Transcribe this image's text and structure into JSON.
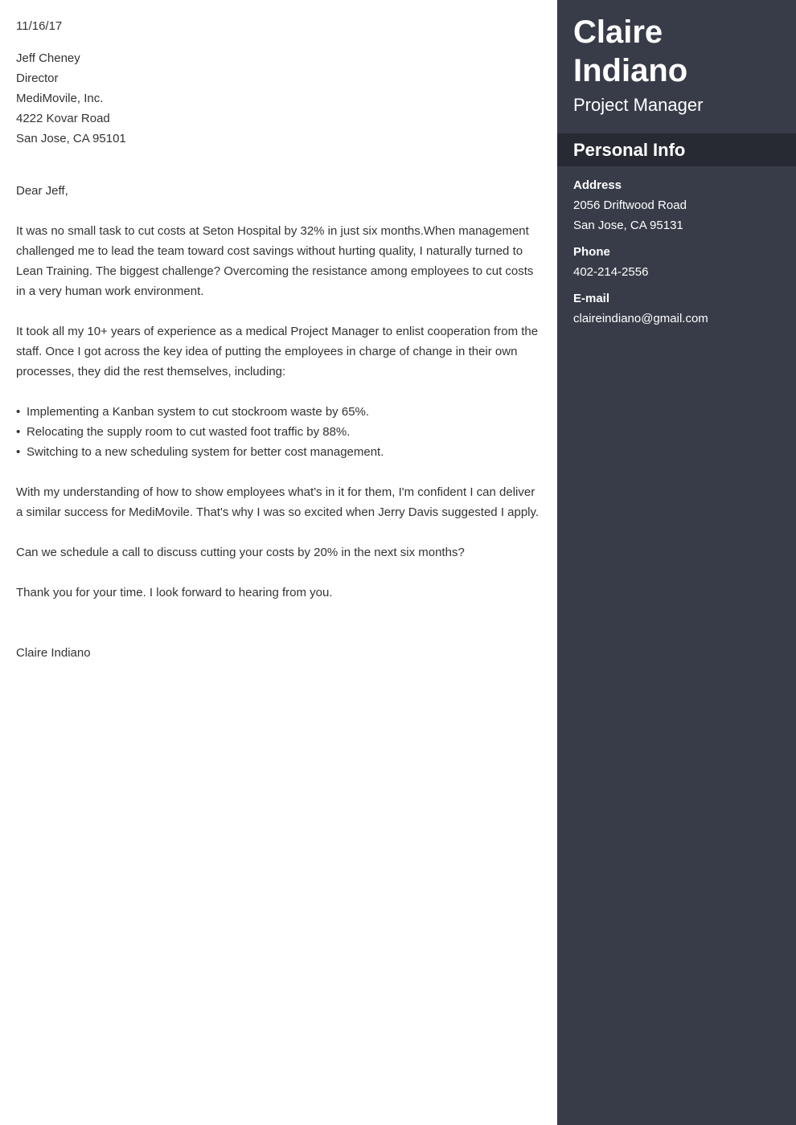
{
  "letter": {
    "date": "11/16/17",
    "recipient": [
      "Jeff Cheney",
      "Director",
      "MediMovile, Inc.",
      "4222 Kovar Road",
      "San Jose, CA 95101"
    ],
    "salutation": "Dear Jeff,",
    "paragraphs": [
      "It was no small task to cut costs at Seton Hospital by 32% in just six months.When management challenged me to lead the team toward cost savings without hurting quality, I naturally turned to Lean Training. The biggest challenge? Overcoming the resistance among employees to cut costs in a very human work environment.",
      "It took all my 10+ years of experience as a medical Project Manager to enlist cooperation from the staff. Once I got across the key idea of putting the employees in charge of change in their own processes, they did the rest themselves, including:"
    ],
    "bullet_symbol": "•",
    "bullets": [
      "Implementing a Kanban system to cut stockroom waste by 65%.",
      "Relocating the supply room to cut wasted foot traffic by 88%.",
      "Switching to a new scheduling system for better cost management."
    ],
    "closing_paragraphs": [
      "With my understanding of how to show employees what's in it for them, I'm confident I can deliver a similar success for MediMovile. That's why I was so excited when Jerry Davis suggested I apply.",
      "Can we schedule a call to discuss cutting your costs by 20% in the next six months?",
      "Thank you for your time. I look forward to hearing from you."
    ],
    "signature": "Claire Indiano"
  },
  "sidebar": {
    "first_name": "Claire",
    "last_name": "Indiano",
    "job_title": "Project Manager",
    "section_title": "Personal Info",
    "address_label": "Address",
    "address_line1": "2056 Driftwood Road",
    "address_line2": "San Jose, CA 95131",
    "phone_label": "Phone",
    "phone": "402-214-2556",
    "email_label": "E-mail",
    "email": "claireindiano@gmail.com"
  },
  "colors": {
    "sidebar_bg": "#383c48",
    "section_header_bg": "#272a33",
    "body_text": "#333333"
  }
}
